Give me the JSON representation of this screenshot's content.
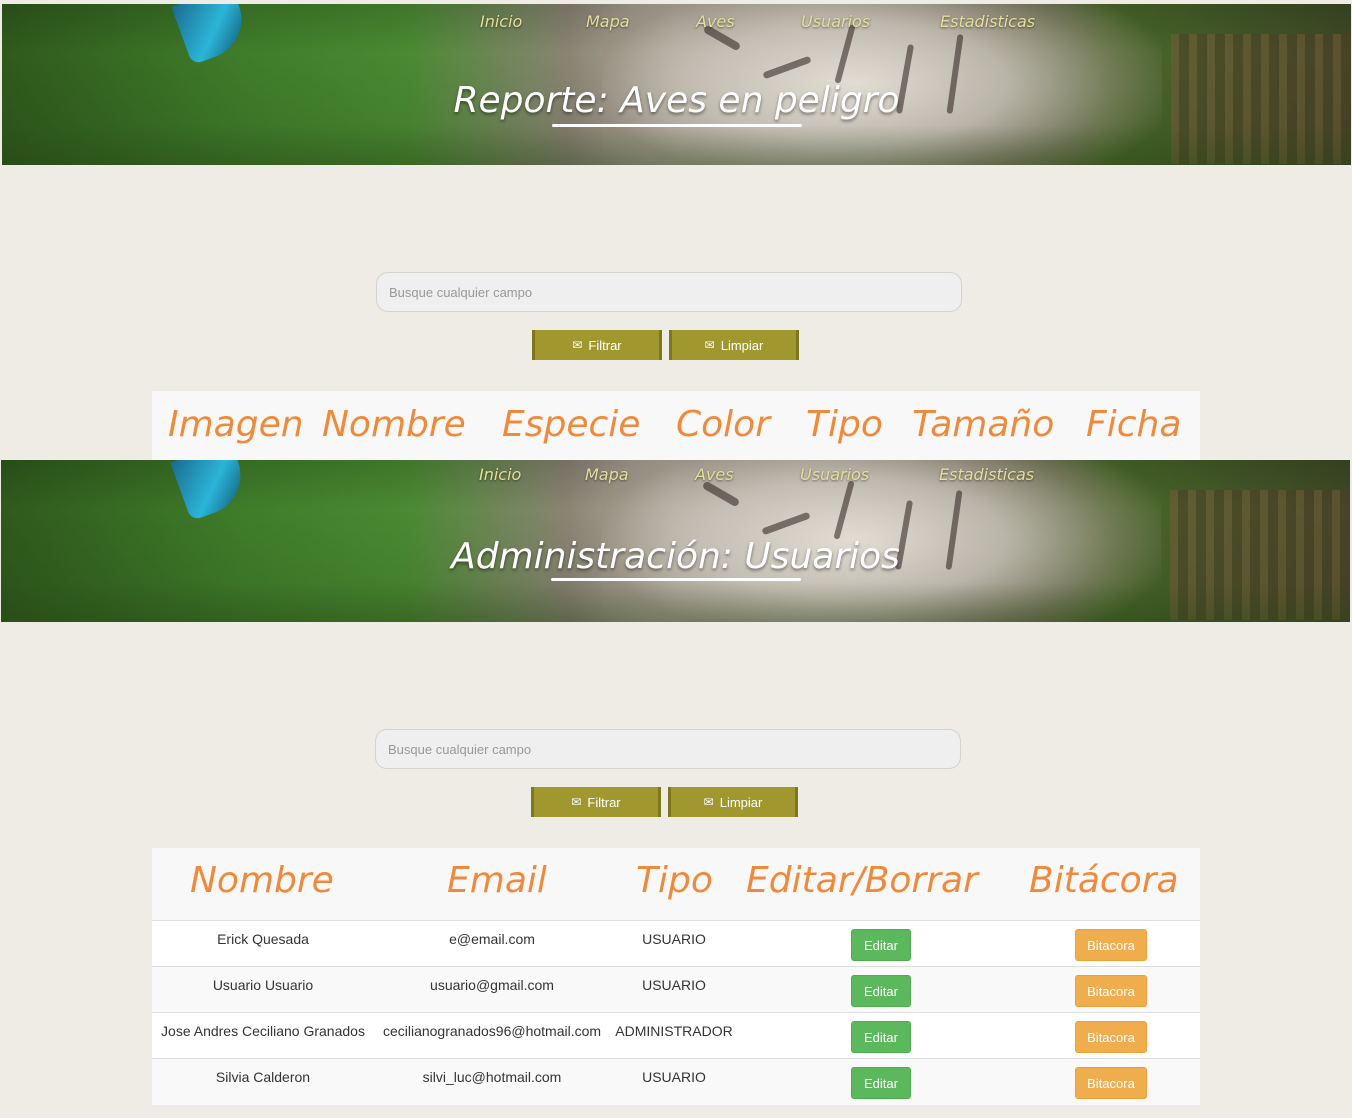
{
  "nav": {
    "items": [
      "Inicio",
      "Mapa",
      "Aves",
      "Usuarios",
      "Estadisticas"
    ]
  },
  "report": {
    "title": "Reporte: Aves en peligro",
    "search_placeholder": "Busque cualquier campo",
    "filter_label": "Filtrar",
    "clear_label": "Limpiar",
    "columns": [
      "Imagen",
      "Nombre",
      "Especie",
      "Color",
      "Tipo",
      "Tamaño",
      "Ficha"
    ]
  },
  "admin": {
    "title": "Administración: Usuarios",
    "search_placeholder": "Busque cualquier campo",
    "filter_label": "Filtrar",
    "clear_label": "Limpiar",
    "columns": [
      "Nombre",
      "Email",
      "Tipo",
      "Editar/Borrar",
      "Bitácora"
    ],
    "edit_label": "Editar",
    "log_label": "Bitacora",
    "rows": [
      {
        "name": "Erick Quesada",
        "email": "e@email.com",
        "type": "USUARIO"
      },
      {
        "name": "Usuario Usuario",
        "email": "usuario@gmail.com",
        "type": "USUARIO"
      },
      {
        "name": "Jose Andres Ceciliano Granados",
        "email": "cecilianogranados96@hotmail.com",
        "type": "ADMINISTRADOR"
      },
      {
        "name": "Silvia Calderon",
        "email": "silvi_luc@hotmail.com",
        "type": "USUARIO"
      }
    ]
  },
  "colors": {
    "accent_orange": "#ef8a3c",
    "olive_button": "#a0982f",
    "edit_green": "#5cb85c",
    "log_orange": "#f0ad4e",
    "nav_text": "#e6de9a",
    "page_bg": "#efebe5"
  }
}
